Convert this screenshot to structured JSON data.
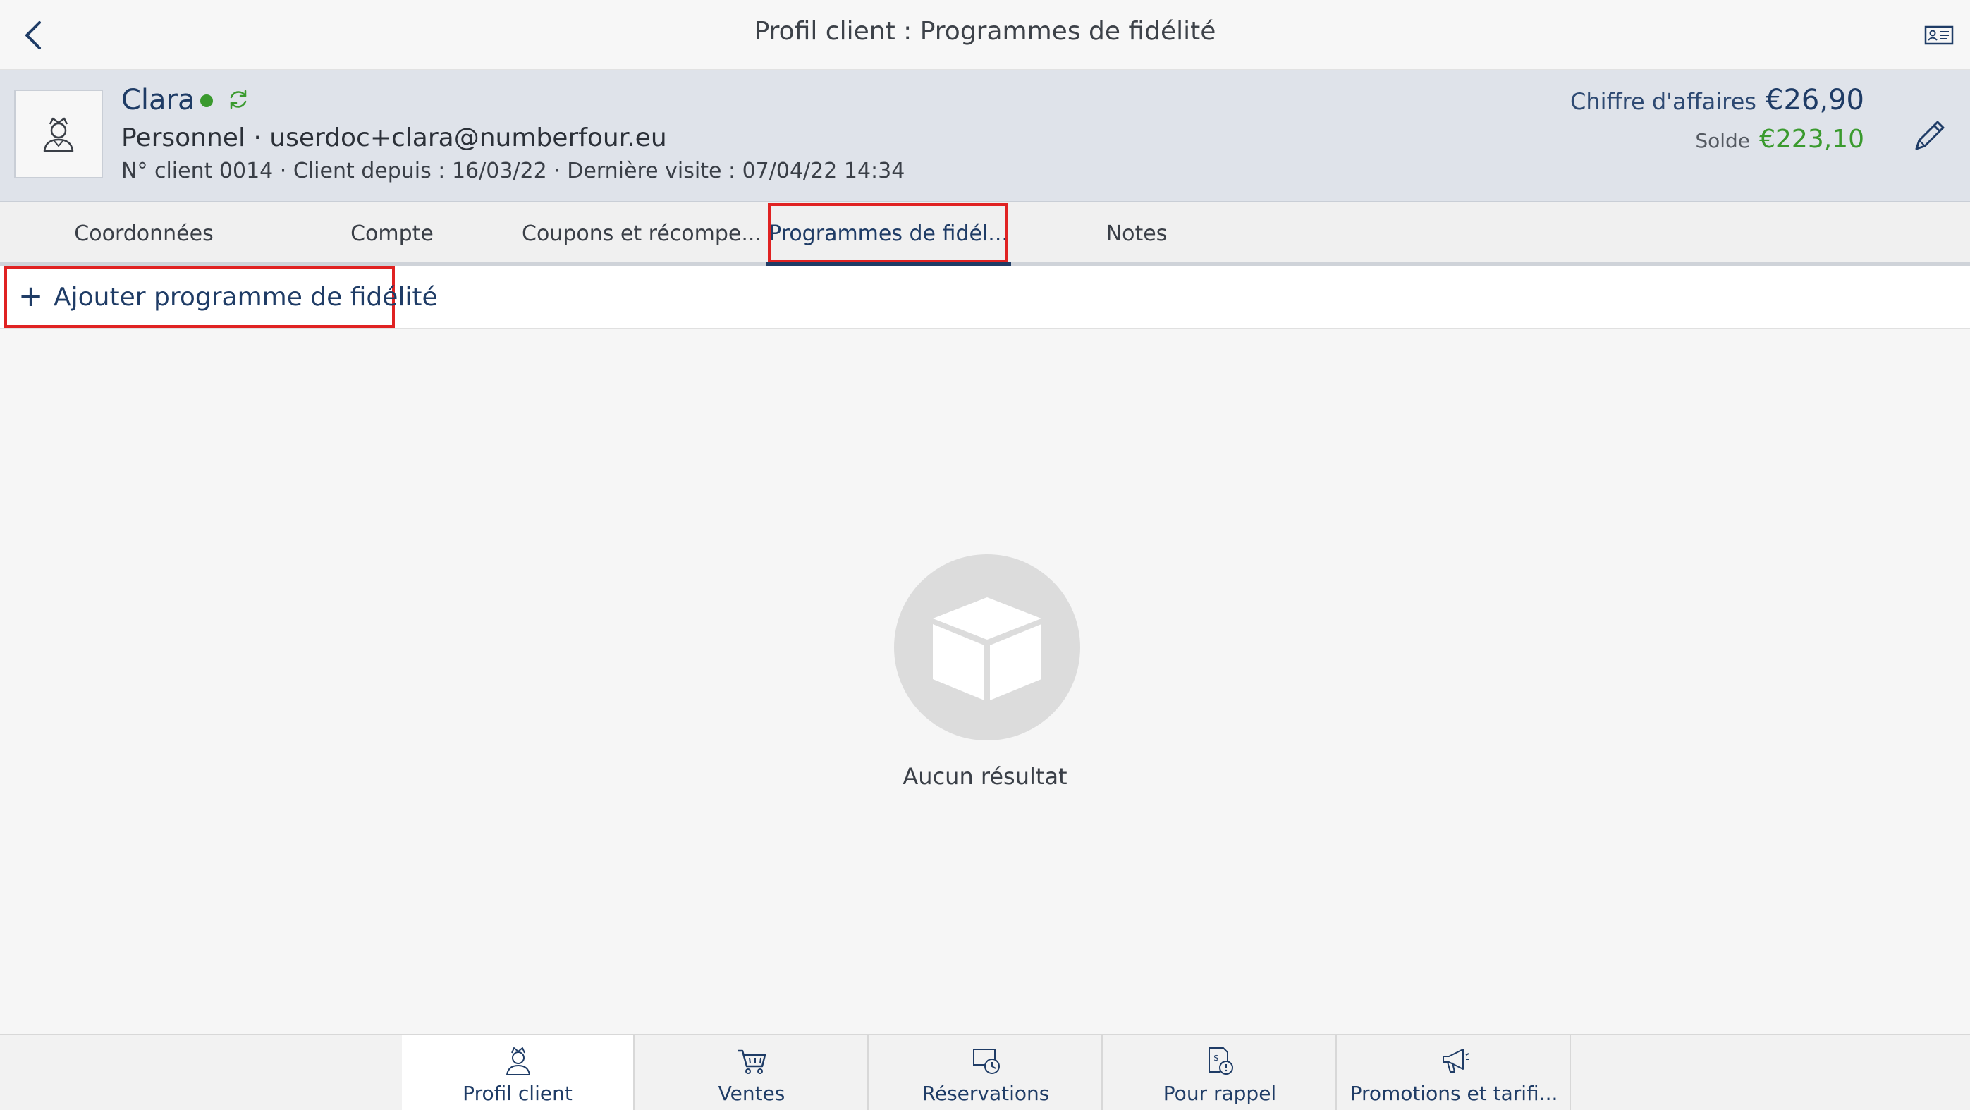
{
  "topbar": {
    "title": "Profil client : Programmes de fidélité",
    "back_icon": "chevron-left-icon",
    "card_icon": "id-card-icon"
  },
  "customer": {
    "name": "Clara",
    "status_color": "#3a9a2e",
    "line2": "Personnel · userdoc+clara@numberfour.eu",
    "line3": "N° client 0014 · Client depuis : 16/03/22 · Dernière visite : 07/04/22 14:34",
    "revenue_label": "Chiffre d'affaires",
    "revenue_value": "€26,90",
    "balance_label": "Solde",
    "balance_value": "€223,10"
  },
  "tabs": [
    {
      "label": "Coordonnées"
    },
    {
      "label": "Compte"
    },
    {
      "label": "Coupons et récompe..."
    },
    {
      "label": "Programmes de fidél...",
      "active": true
    },
    {
      "label": "Notes"
    }
  ],
  "add_program": {
    "plus": "+",
    "label": "Ajouter programme de fidélité"
  },
  "empty_state": {
    "icon": "box-icon",
    "text": "Aucun résultat"
  },
  "bottom_nav": [
    {
      "label": "Profil client",
      "icon": "customer-icon",
      "active": true
    },
    {
      "label": "Ventes",
      "icon": "cart-icon"
    },
    {
      "label": "Réservations",
      "icon": "reservation-clock-icon"
    },
    {
      "label": "Pour rappel",
      "icon": "reminder-icon"
    },
    {
      "label": "Promotions et tarifi...",
      "icon": "megaphone-icon"
    }
  ],
  "colors": {
    "accent": "#1f3c66",
    "highlight": "#e02222",
    "positive": "#3a9a2e"
  }
}
